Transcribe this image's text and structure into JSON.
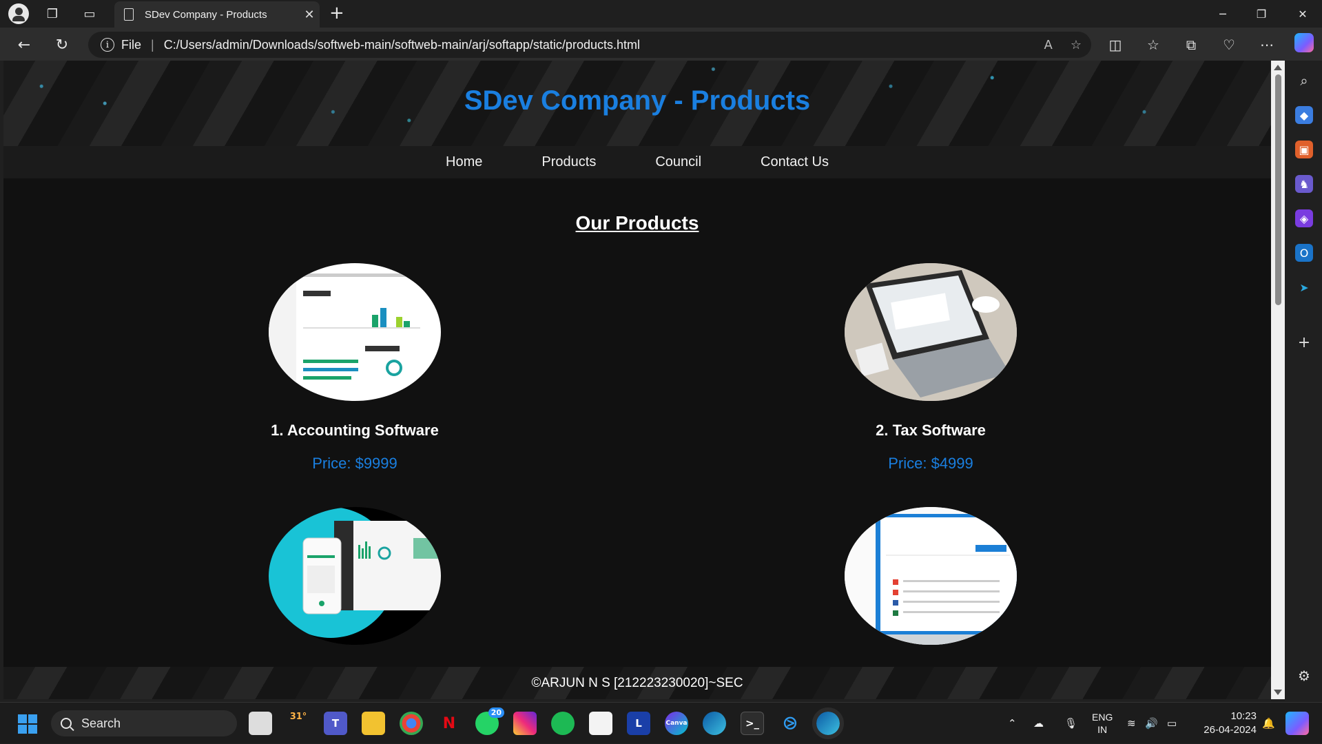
{
  "browser": {
    "tab_title": "SDev Company - Products",
    "address_scheme": "File",
    "address_url": "C:/Users/admin/Downloads/softweb-main/softweb-main/arj/softapp/static/products.html"
  },
  "page": {
    "header_title": "SDev Company - Products",
    "nav": [
      {
        "label": "Home"
      },
      {
        "label": "Products"
      },
      {
        "label": "Council"
      },
      {
        "label": "Contact Us"
      }
    ],
    "section_title": "Our Products",
    "products": [
      {
        "name": "1. Accounting Software",
        "price": "Price: $9999"
      },
      {
        "name": "2. Tax Software",
        "price": "Price: $4999"
      },
      {
        "name": "",
        "price": ""
      },
      {
        "name": "",
        "price": ""
      }
    ],
    "footer": "©ARJUN N S [212223230020]~SEC"
  },
  "taskbar": {
    "search_placeholder": "Search",
    "weather_temp": "31°",
    "whatsapp_badge": "20",
    "language": "ENG",
    "region": "IN",
    "time": "10:23",
    "date": "26-04-2024"
  },
  "colors": {
    "accent_blue": "#1a7fe0",
    "page_bg": "#111111",
    "nav_bg": "#1b1b1b"
  }
}
